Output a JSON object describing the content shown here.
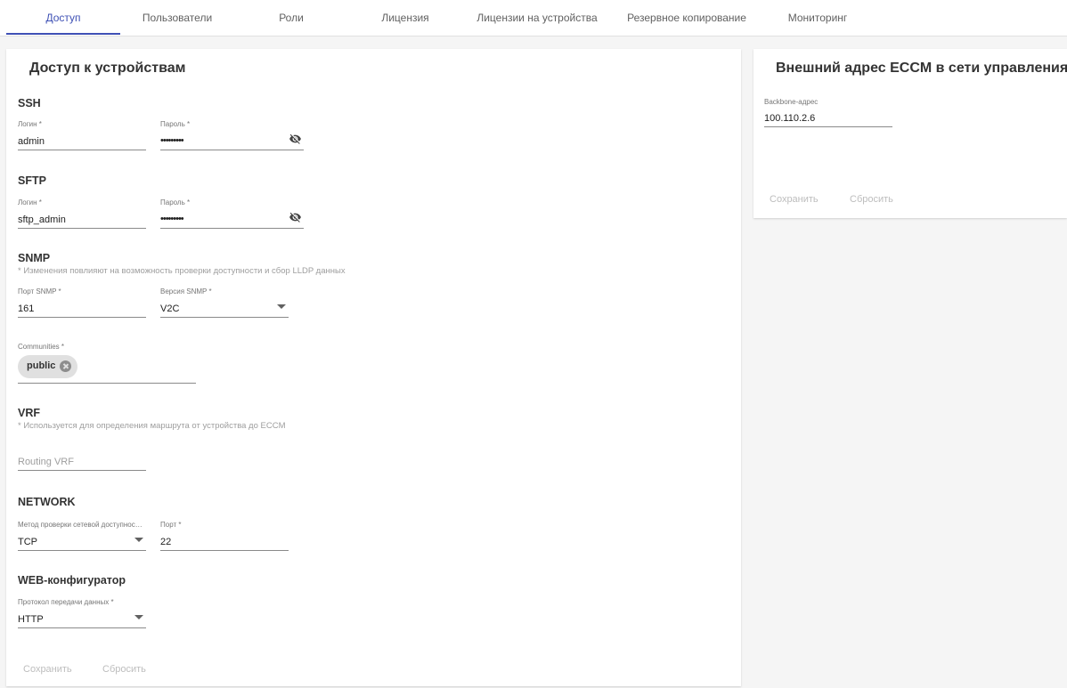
{
  "tabs": [
    {
      "label": "Доступ"
    },
    {
      "label": "Пользователи"
    },
    {
      "label": "Роли"
    },
    {
      "label": "Лицензия"
    },
    {
      "label": "Лицензии на устройства"
    },
    {
      "label": "Резервное копирование"
    },
    {
      "label": "Мониторинг"
    }
  ],
  "access": {
    "title": "Доступ к устройствам",
    "ssh": {
      "title": "SSH",
      "login_label": "Логин *",
      "login_value": "admin",
      "password_label": "Пароль *",
      "password_value": "•••••••••"
    },
    "sftp": {
      "title": "SFTP",
      "login_label": "Логин *",
      "login_value": "sftp_admin",
      "password_label": "Пароль *",
      "password_value": "•••••••••"
    },
    "snmp": {
      "title": "SNMP",
      "hint": "* Изменения повлияют на возможность проверки доступности и сбор LLDP данных",
      "port_label": "Порт SNMP *",
      "port_value": "161",
      "version_label": "Версия SNMP *",
      "version_value": "V2C",
      "communities_label": "Communities *",
      "communities": [
        "public"
      ]
    },
    "vrf": {
      "title": "VRF",
      "hint": "* Используется для определения маршрута от устройства до ECCM",
      "routing_placeholder": "Routing VRF"
    },
    "network": {
      "title": "NETWORK",
      "method_label": "Метод проверки сетевой доступности *",
      "method_value": "TCP",
      "port_label": "Порт *",
      "port_value": "22"
    },
    "web": {
      "title": "WEB-конфигуратор",
      "protocol_label": "Протокол передачи данных *",
      "protocol_value": "HTTP"
    },
    "save_label": "Сохранить",
    "reset_label": "Сбросить"
  },
  "external": {
    "title": "Внешний адрес ECCM в сети управления",
    "backbone_label": "Backbone-адрес",
    "backbone_value": "100.110.2.6",
    "save_label": "Сохранить",
    "reset_label": "Сбросить"
  },
  "colors": {
    "accent": "#3f51b5",
    "disabled_text": "#bdbdbd",
    "background": "#f5f5f5"
  },
  "icons": {
    "password_toggle": "eye-off-icon",
    "select": "caret-down-icon",
    "chip_remove": "close-circle-icon"
  }
}
